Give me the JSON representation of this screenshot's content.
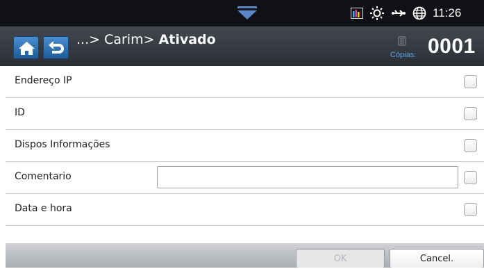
{
  "status_bar": {
    "time": "11:26",
    "icons": [
      "toner-level-icon",
      "brightness-icon",
      "network-icon",
      "globe-icon"
    ]
  },
  "header": {
    "breadcrumb_prefix": "...> Carim> ",
    "breadcrumb_current": "Ativado",
    "copies_label": "Cópias:",
    "copies_count": "0001"
  },
  "list": {
    "items": [
      {
        "label": "Endereço IP",
        "checked": false
      },
      {
        "label": "ID",
        "checked": false
      },
      {
        "label": "Dispos Informações",
        "checked": false
      },
      {
        "label": "Comentario",
        "checked": false,
        "input_value": ""
      },
      {
        "label": "Data e hora",
        "checked": false
      }
    ]
  },
  "footer": {
    "ok_label": "OK",
    "cancel_label": "Cancel."
  },
  "colors": {
    "accent_blue": "#2f74b8",
    "status_bar_bg": "#0f1114",
    "header_bg": "#33373d"
  }
}
